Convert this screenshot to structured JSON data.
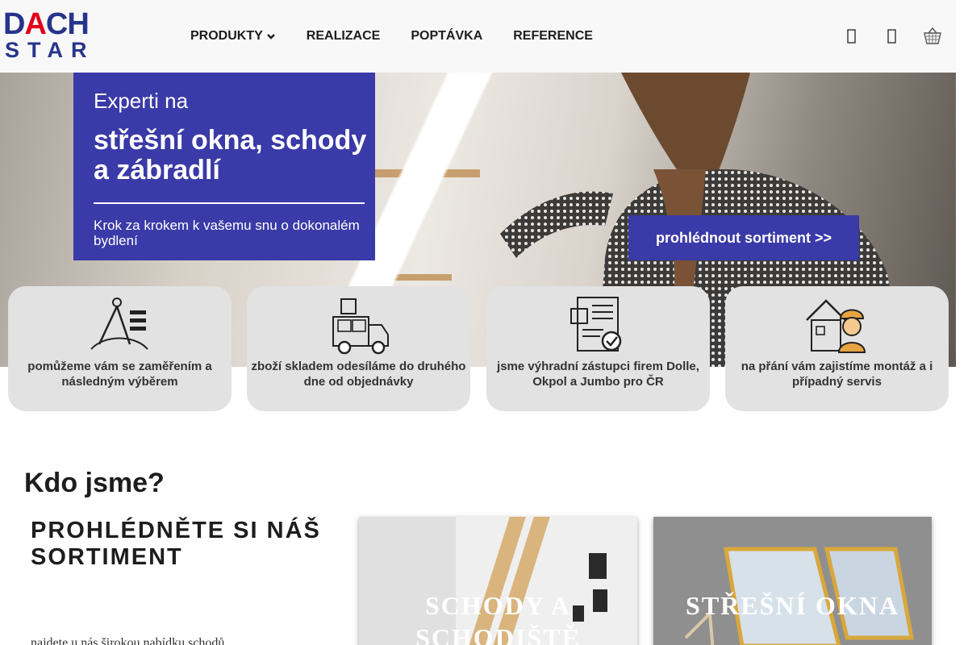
{
  "header": {
    "logo": {
      "line1": [
        "D",
        "A",
        "CH"
      ],
      "line2": "STAR"
    },
    "nav": [
      {
        "label": "PRODUKTY",
        "has_dropdown": true
      },
      {
        "label": "REALIZACE"
      },
      {
        "label": "POPTÁVKA"
      },
      {
        "label": "REFERENCE"
      }
    ],
    "icons": [
      "search-icon",
      "user-icon",
      "basket-icon"
    ]
  },
  "hero": {
    "box": {
      "line1": "Experti na",
      "headline": "střešní okna, schody a zábradlí",
      "subline": "Krok za krokem k vašemu snu o dokonalém bydlení"
    },
    "cta_label": "prohlédnout sortiment >>",
    "colors": {
      "brand_blue": "#3a3aa8"
    }
  },
  "features": [
    {
      "icon": "compass-ruler-icon",
      "text": "pomůžeme vám se zaměřením a následným výběrem"
    },
    {
      "icon": "delivery-truck-icon",
      "text": "zboží skladem odesíláme do druhého dne od objednávky"
    },
    {
      "icon": "certified-document-icon",
      "text": "jsme výhradní zástupci firem Dolle, Okpol a Jumbo pro ČR"
    },
    {
      "icon": "worker-house-icon",
      "text": "na přání vám zajistíme montáž a i případný servis"
    }
  ],
  "about": {
    "title": "Kdo jsme?",
    "sortiment_title": "PROHLÉDNĚTE SI NÁŠ SORTIMENT",
    "paragraph": "najdete u nás širokou nabídku schodů"
  },
  "categories": [
    {
      "label": "SCHODY A SCHODIŠTĚ"
    },
    {
      "label": "STŘEŠNÍ OKNA"
    }
  ]
}
